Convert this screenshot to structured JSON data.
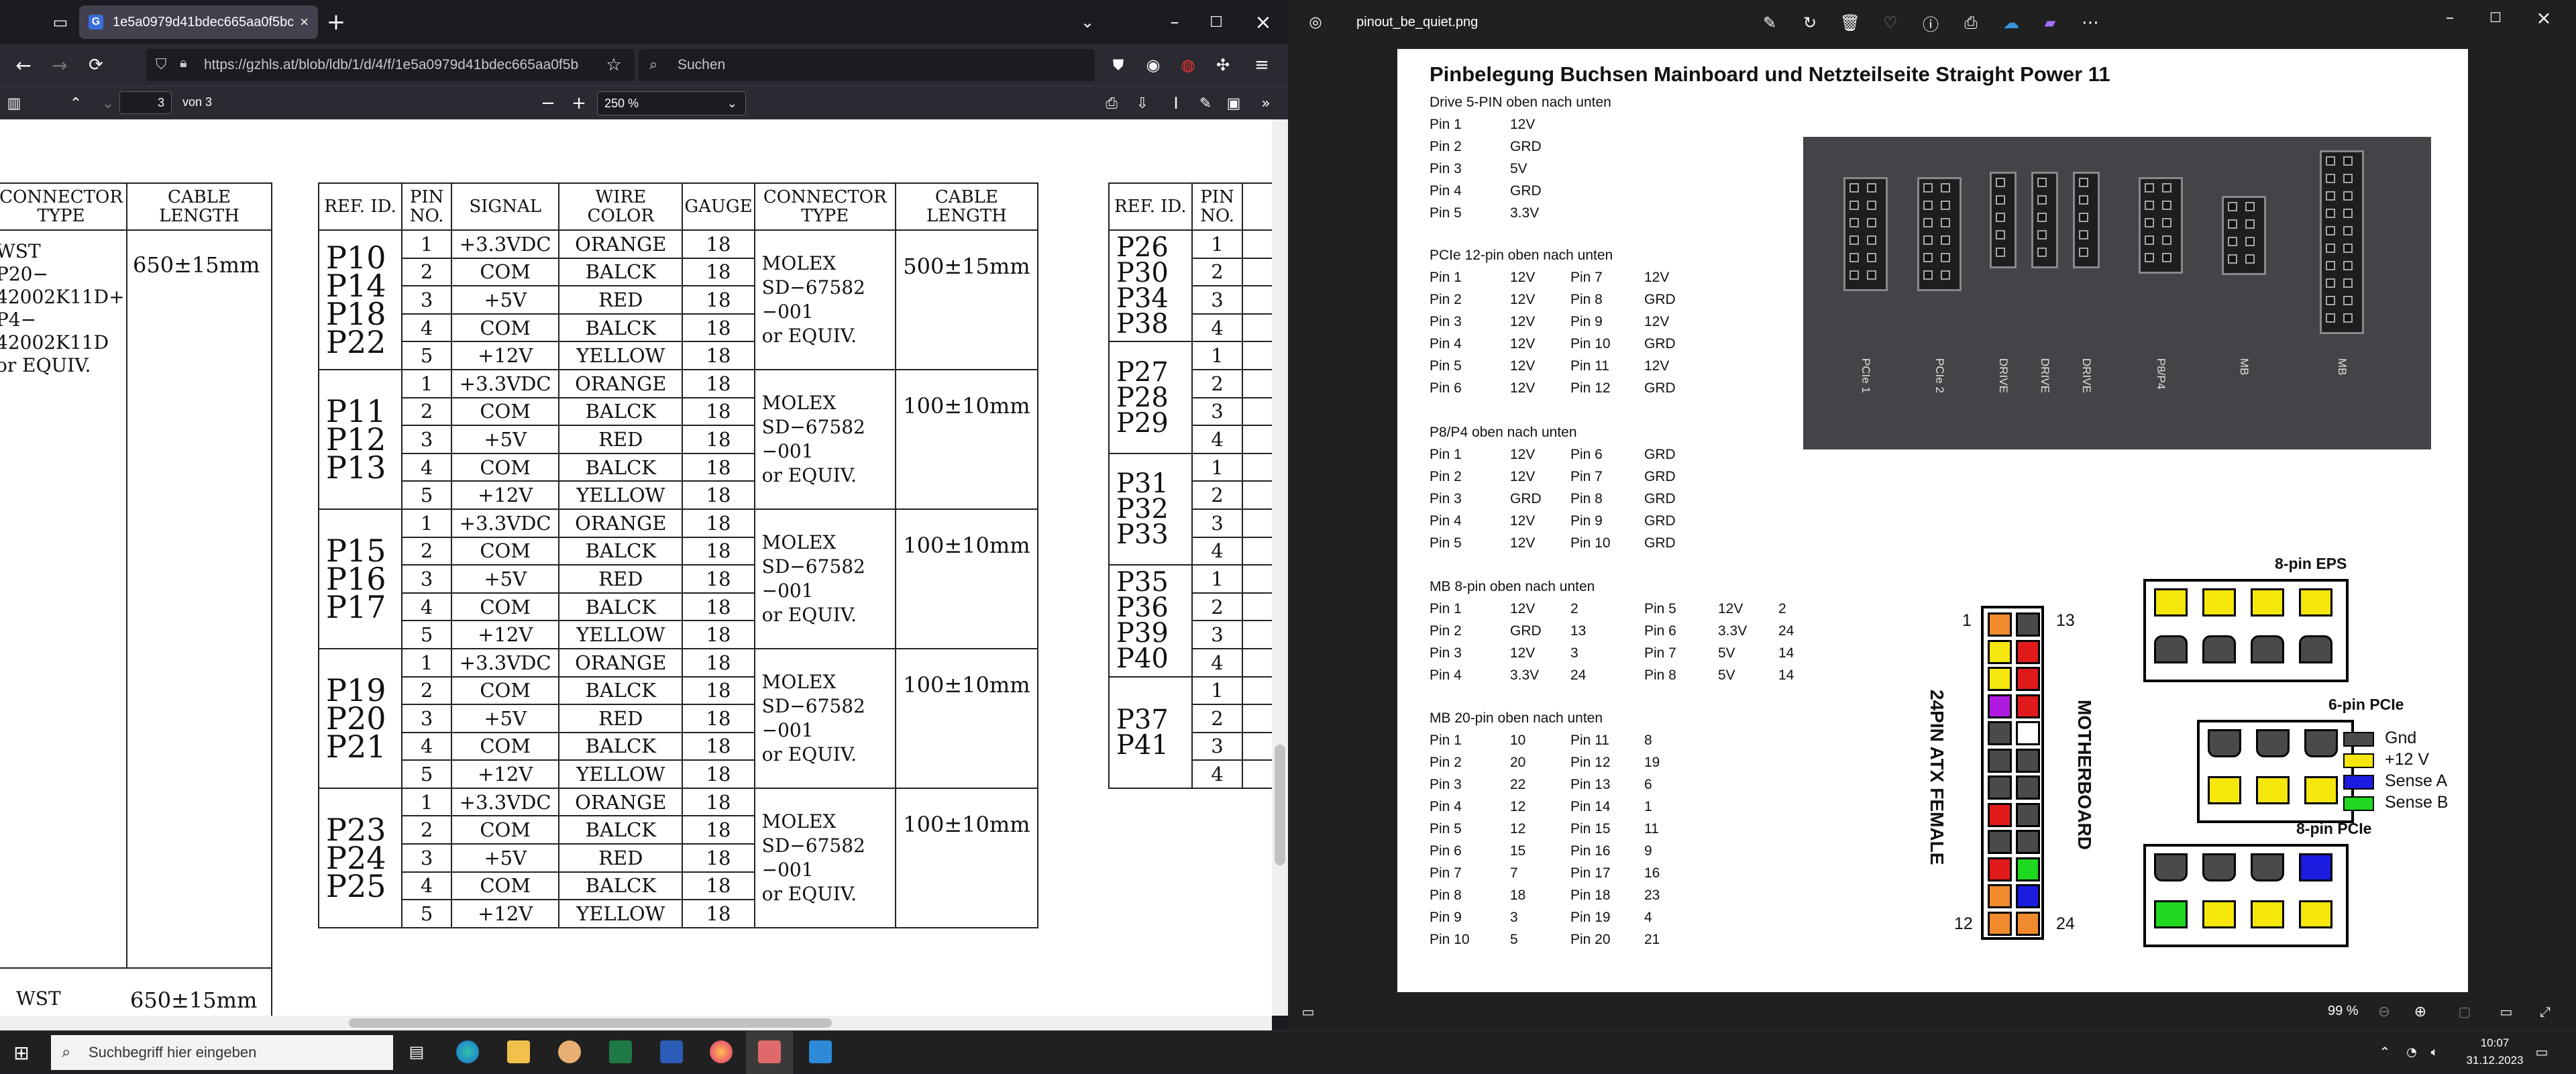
{
  "browser": {
    "tab_title": "1e5a0979d41bdec665aa0f5bc",
    "tab_favicon_letter": "G",
    "url": "https://gzhls.at/blob/ldb/1/d/4/f/1e5a0979d41bdec665aa0f5b",
    "search_placeholder": "Suchen",
    "page_current": "3",
    "page_total": "von 3",
    "zoom": "250 %"
  },
  "pdf": {
    "left_headers": {
      "connector_type": "CONNECTOR TYPE",
      "cable_length": "CABLE LENGTH"
    },
    "left_connector": "WST\nP20−\n42002K11D+\nP4−\n42002K11D\nor EQUIV.",
    "left_length": "650±15mm",
    "left_bottom_connector": "WST",
    "left_bottom_length": "650±15mm",
    "main_headers": {
      "ref": "REF. ID.",
      "pin": "PIN NO.",
      "signal": "SIGNAL",
      "wire": "WIRE COLOR",
      "gauge": "GAUGE",
      "connector": "CONNECTOR TYPE",
      "length": "CABLE LENGTH"
    },
    "groups": [
      {
        "refs": "P10\nP14\nP18\nP22",
        "connector": "MOLEX\nSD−67582\n−001\nor EQUIV.",
        "length": "500±15mm",
        "rows": [
          [
            "1",
            "+3.3VDC",
            "ORANGE",
            "18"
          ],
          [
            "2",
            "COM",
            "BALCK",
            "18"
          ],
          [
            "3",
            "+5V",
            "RED",
            "18"
          ],
          [
            "4",
            "COM",
            "BALCK",
            "18"
          ],
          [
            "5",
            "+12V",
            "YELLOW",
            "18"
          ]
        ]
      },
      {
        "refs": "P11\nP12\nP13",
        "connector": "MOLEX\nSD−67582\n−001\nor EQUIV.",
        "length": "100±10mm",
        "rows": [
          [
            "1",
            "+3.3VDC",
            "ORANGE",
            "18"
          ],
          [
            "2",
            "COM",
            "BALCK",
            "18"
          ],
          [
            "3",
            "+5V",
            "RED",
            "18"
          ],
          [
            "4",
            "COM",
            "BALCK",
            "18"
          ],
          [
            "5",
            "+12V",
            "YELLOW",
            "18"
          ]
        ]
      },
      {
        "refs": "P15\nP16\nP17",
        "connector": "MOLEX\nSD−67582\n−001\nor EQUIV.",
        "length": "100±10mm",
        "rows": [
          [
            "1",
            "+3.3VDC",
            "ORANGE",
            "18"
          ],
          [
            "2",
            "COM",
            "BALCK",
            "18"
          ],
          [
            "3",
            "+5V",
            "RED",
            "18"
          ],
          [
            "4",
            "COM",
            "BALCK",
            "18"
          ],
          [
            "5",
            "+12V",
            "YELLOW",
            "18"
          ]
        ]
      },
      {
        "refs": "P19\nP20\nP21",
        "connector": "MOLEX\nSD−67582\n−001\nor EQUIV.",
        "length": "100±10mm",
        "rows": [
          [
            "1",
            "+3.3VDC",
            "ORANGE",
            "18"
          ],
          [
            "2",
            "COM",
            "BALCK",
            "18"
          ],
          [
            "3",
            "+5V",
            "RED",
            "18"
          ],
          [
            "4",
            "COM",
            "BALCK",
            "18"
          ],
          [
            "5",
            "+12V",
            "YELLOW",
            "18"
          ]
        ]
      },
      {
        "refs": "P23\nP24\nP25",
        "connector": "MOLEX\nSD−67582\n−001\nor EQUIV.",
        "length": "100±10mm",
        "rows": [
          [
            "1",
            "+3.3VDC",
            "ORANGE",
            "18"
          ],
          [
            "2",
            "COM",
            "BALCK",
            "18"
          ],
          [
            "3",
            "+5V",
            "RED",
            "18"
          ],
          [
            "4",
            "COM",
            "BALCK",
            "18"
          ],
          [
            "5",
            "+12V",
            "YELLOW",
            "18"
          ]
        ]
      }
    ],
    "right_headers": {
      "ref": "REF. ID.",
      "pin": "PIN NO."
    },
    "right_groups": [
      {
        "refs": "P26\nP30\nP34\nP38",
        "pins": [
          "1",
          "2",
          "3",
          "4"
        ]
      },
      {
        "refs": "P27\nP28\nP29",
        "pins": [
          "1",
          "2",
          "3",
          "4"
        ]
      },
      {
        "refs": "P31\nP32\nP33",
        "pins": [
          "1",
          "2",
          "3",
          "4"
        ]
      },
      {
        "refs": "P35\nP36\nP39\nP40",
        "pins": [
          "1",
          "2",
          "3",
          "4"
        ]
      },
      {
        "refs": "P37\nP41",
        "pins": [
          "1",
          "2",
          "3",
          "4"
        ]
      }
    ]
  },
  "photos": {
    "filename": "pinout_be_quiet.png",
    "zoom": "99 %",
    "doc_title": "Pinbelegung Buchsen Mainboard und Netzteilseite Straight Power 11",
    "drive": {
      "title": "Drive 5-PIN oben nach unten",
      "rows": [
        [
          "Pin 1",
          "12V"
        ],
        [
          "Pin 2",
          "GRD"
        ],
        [
          "Pin 3",
          "5V"
        ],
        [
          "Pin 4",
          "GRD"
        ],
        [
          "Pin 5",
          "3.3V"
        ]
      ]
    },
    "pcie": {
      "title": "PCIe 12-pin oben nach unten",
      "rows": [
        [
          "Pin 1",
          "12V",
          "Pin 7",
          "12V"
        ],
        [
          "Pin 2",
          "12V",
          "Pin 8",
          "GRD"
        ],
        [
          "Pin 3",
          "12V",
          "Pin 9",
          "12V"
        ],
        [
          "Pin 4",
          "12V",
          "Pin 10",
          "GRD"
        ],
        [
          "Pin 5",
          "12V",
          "Pin 11",
          "12V"
        ],
        [
          "Pin 6",
          "12V",
          "Pin 12",
          "GRD"
        ]
      ]
    },
    "p8p4": {
      "title": "P8/P4 oben nach unten",
      "rows": [
        [
          "Pin 1",
          "12V",
          "Pin 6",
          "GRD"
        ],
        [
          "Pin 2",
          "12V",
          "Pin 7",
          "GRD"
        ],
        [
          "Pin 3",
          "GRD",
          "Pin 8",
          "GRD"
        ],
        [
          "Pin 4",
          "12V",
          "Pin 9",
          "GRD"
        ],
        [
          "Pin 5",
          "12V",
          "Pin 10",
          "GRD"
        ]
      ]
    },
    "mb8": {
      "title": "MB 8-pin oben nach unten",
      "rows": [
        [
          "Pin 1",
          "12V",
          "2",
          "Pin 5",
          "12V",
          "2"
        ],
        [
          "Pin 2",
          "GRD",
          "13",
          "Pin 6",
          "3.3V",
          "24"
        ],
        [
          "Pin 3",
          "12V",
          "3",
          "Pin 7",
          "5V",
          "14"
        ],
        [
          "Pin 4",
          "3.3V",
          "24",
          "Pin 8",
          "5V",
          "14"
        ]
      ]
    },
    "mb20": {
      "title": "MB 20-pin oben nach unten",
      "rows": [
        [
          "Pin 1",
          "10",
          "Pin 11",
          "8"
        ],
        [
          "Pin 2",
          "20",
          "Pin 12",
          "19"
        ],
        [
          "Pin 3",
          "22",
          "Pin 13",
          "6"
        ],
        [
          "Pin 4",
          "12",
          "Pin 14",
          "1"
        ],
        [
          "Pin 5",
          "12",
          "Pin 15",
          "11"
        ],
        [
          "Pin 6",
          "15",
          "Pin 16",
          "9"
        ],
        [
          "Pin 7",
          "7",
          "Pin 17",
          "16"
        ],
        [
          "Pin 8",
          "18",
          "Pin 18",
          "23"
        ],
        [
          "Pin 9",
          "3",
          "Pin 19",
          "4"
        ],
        [
          "Pin 10",
          "5",
          "Pin 20",
          "21"
        ]
      ]
    },
    "photo_labels": [
      "PCIe 1",
      "PCIe 2",
      "DRIVE",
      "DRIVE",
      "DRIVE",
      "P8/P4",
      "MB",
      "MB"
    ],
    "atx": {
      "label_vertical": "24PIN ATX FEMALE",
      "label_mb": "MOTHERBOARD",
      "n1": "1",
      "n13": "13",
      "n12": "12",
      "n24": "24"
    },
    "eps_title": "8-pin EPS",
    "pcie6_title": "6-pin PCIe",
    "pcie8_title": "8-pin PCIe",
    "legend": [
      "Gnd",
      "+12 V",
      "Sense A",
      "Sense B"
    ],
    "colors": {
      "gnd": "#4a4a4a",
      "v12": "#f5e60c",
      "senseA": "#1c1ce0",
      "senseB": "#1fd81f",
      "v3": "#f08a2c",
      "v5": "#e01a1a",
      "purple": "#b01ae0"
    }
  },
  "taskbar": {
    "search_placeholder": "Suchbegriff hier eingeben",
    "time": "10:07",
    "date": "31.12.2023"
  }
}
